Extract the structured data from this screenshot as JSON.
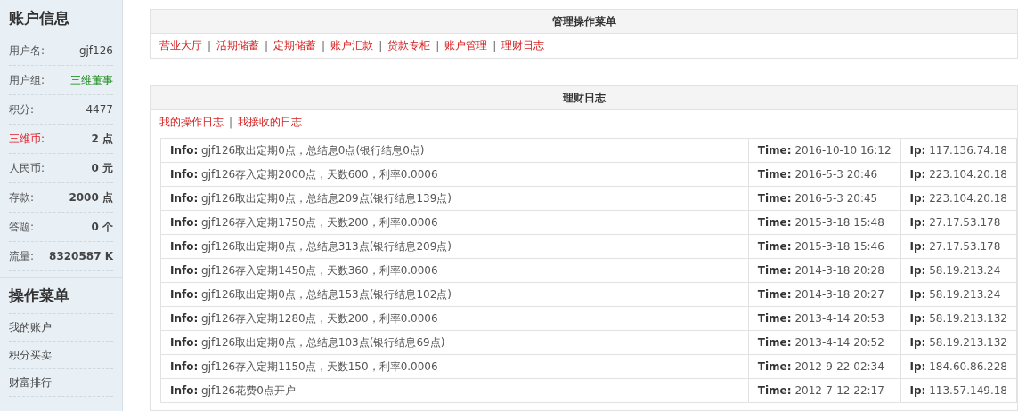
{
  "sidebar": {
    "account_title": "账户信息",
    "fields": [
      {
        "label": "用户名:",
        "value": "gjf126",
        "kind": "plain"
      },
      {
        "label": "用户组:",
        "value": "三维董事",
        "kind": "group"
      },
      {
        "label": "积分:",
        "value": "4477",
        "kind": "plain"
      },
      {
        "label": "三维币:",
        "value": "2 点",
        "kind": "alert"
      },
      {
        "label": "人民币:",
        "value": "0 元",
        "kind": "bold"
      },
      {
        "label": "存款:",
        "value": "2000 点",
        "kind": "bold"
      },
      {
        "label": "答题:",
        "value": "0 个",
        "kind": "bold"
      },
      {
        "label": "流量:",
        "value": "8320587 K",
        "kind": "bold"
      }
    ],
    "menu_title": "操作菜单",
    "menu_items": [
      "我的账户",
      "积分买卖",
      "财富排行"
    ]
  },
  "menu_panel": {
    "title": "管理操作菜单",
    "links": [
      {
        "label": "营业大厅"
      },
      {
        "separator": "|",
        "label": "活期储蓄"
      },
      {
        "separator": "|",
        "label": "定期储蓄"
      },
      {
        "separator": "|",
        "label": "账户汇款"
      },
      {
        "separator": "|",
        "label": "贷款专柜"
      },
      {
        "separator": "|",
        "label": "账户管理"
      },
      {
        "separator": "|",
        "label": "理财日志"
      }
    ]
  },
  "log_panel": {
    "title": "理财日志",
    "links": [
      {
        "label": "我的操作日志"
      },
      {
        "separator": "|",
        "label": "我接收的日志"
      }
    ],
    "rows": [
      {
        "info_label": "Info:",
        "info": "gjf126取出定期0点，总结息0点(银行结息0点)",
        "time_label": "Time:",
        "time": "2016-10-10 16:12",
        "ip_label": "Ip:",
        "ip": "117.136.74.18"
      },
      {
        "info_label": "Info:",
        "info": "gjf126存入定期2000点，天数600，利率0.0006",
        "time_label": "Time:",
        "time": "2016-5-3 20:46",
        "ip_label": "Ip:",
        "ip": "223.104.20.18"
      },
      {
        "info_label": "Info:",
        "info": "gjf126取出定期0点，总结息209点(银行结息139点)",
        "time_label": "Time:",
        "time": "2016-5-3 20:45",
        "ip_label": "Ip:",
        "ip": "223.104.20.18"
      },
      {
        "info_label": "Info:",
        "info": "gjf126存入定期1750点，天数200，利率0.0006",
        "time_label": "Time:",
        "time": "2015-3-18 15:48",
        "ip_label": "Ip:",
        "ip": "27.17.53.178"
      },
      {
        "info_label": "Info:",
        "info": "gjf126取出定期0点，总结息313点(银行结息209点)",
        "time_label": "Time:",
        "time": "2015-3-18 15:46",
        "ip_label": "Ip:",
        "ip": "27.17.53.178"
      },
      {
        "info_label": "Info:",
        "info": "gjf126存入定期1450点，天数360，利率0.0006",
        "time_label": "Time:",
        "time": "2014-3-18 20:28",
        "ip_label": "Ip:",
        "ip": "58.19.213.24"
      },
      {
        "info_label": "Info:",
        "info": "gjf126取出定期0点，总结息153点(银行结息102点)",
        "time_label": "Time:",
        "time": "2014-3-18 20:27",
        "ip_label": "Ip:",
        "ip": "58.19.213.24"
      },
      {
        "info_label": "Info:",
        "info": "gjf126存入定期1280点，天数200，利率0.0006",
        "time_label": "Time:",
        "time": "2013-4-14 20:53",
        "ip_label": "Ip:",
        "ip": "58.19.213.132"
      },
      {
        "info_label": "Info:",
        "info": "gjf126取出定期0点，总结息103点(银行结息69点)",
        "time_label": "Time:",
        "time": "2013-4-14 20:52",
        "ip_label": "Ip:",
        "ip": "58.19.213.132"
      },
      {
        "info_label": "Info:",
        "info": "gjf126存入定期1150点，天数150，利率0.0006",
        "time_label": "Time:",
        "time": "2012-9-22 02:34",
        "ip_label": "Ip:",
        "ip": "184.60.86.228"
      },
      {
        "info_label": "Info:",
        "info": "gjf126花费0点开户",
        "time_label": "Time:",
        "time": "2012-7-12 22:17",
        "ip_label": "Ip:",
        "ip": "113.57.149.18"
      }
    ]
  }
}
